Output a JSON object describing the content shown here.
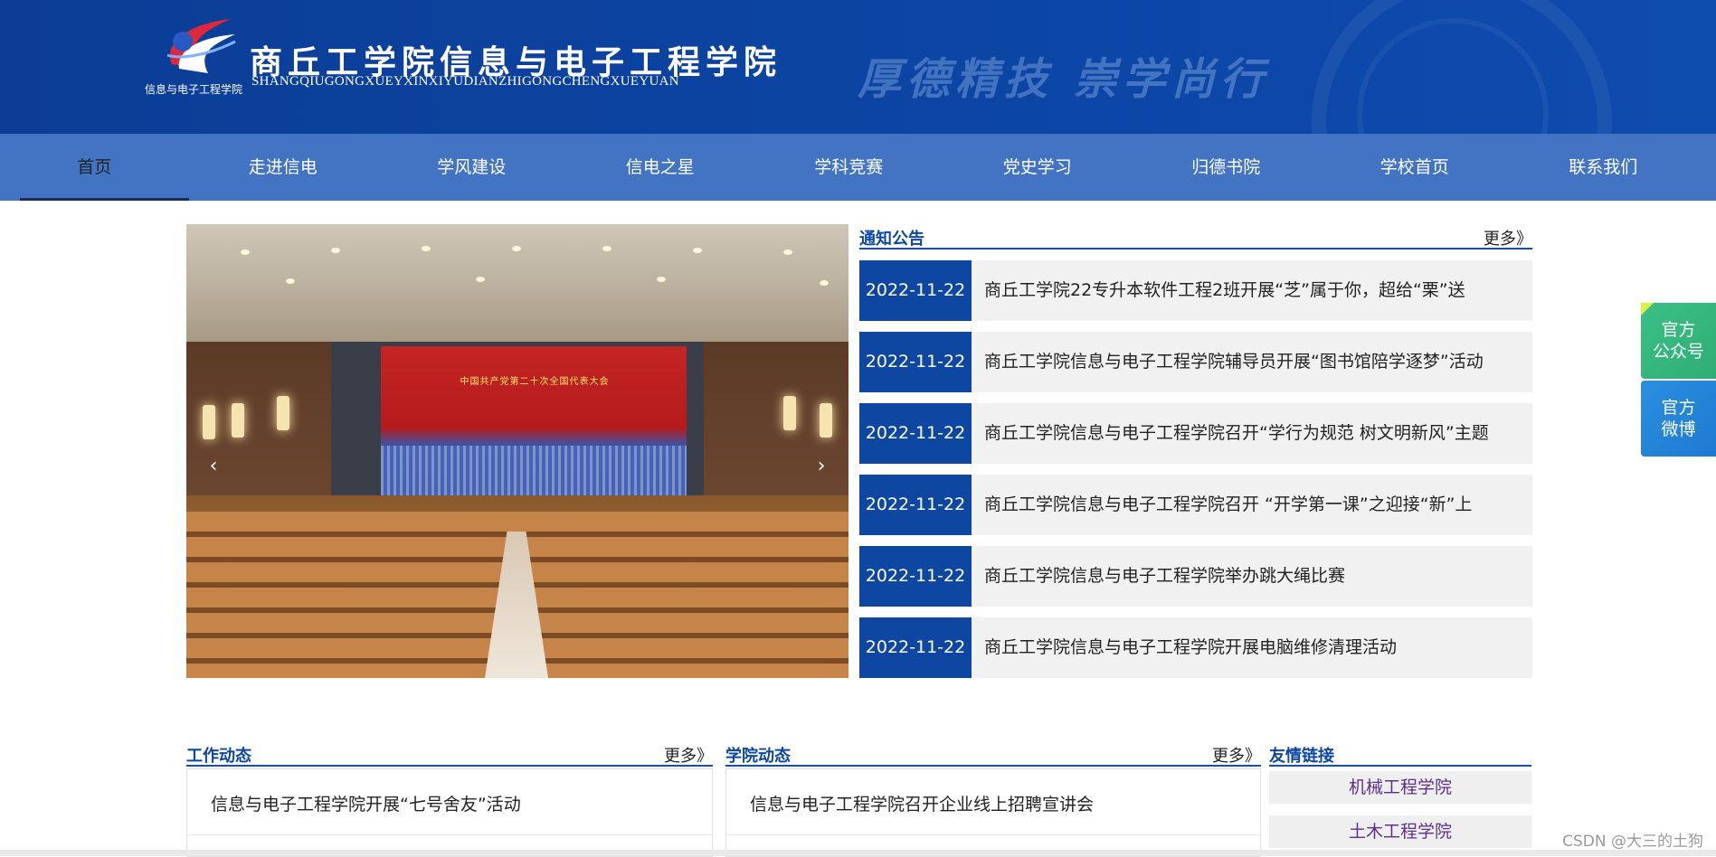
{
  "header": {
    "title": "商丘工学院信息与电子工程学院",
    "pinyin": "SHANGQIUGONGXUEYXINXIYUDIANZHIGONGCHENGXUEYUAN",
    "logo_text": "信息与电子工程学院",
    "motto": "厚德精技  崇学尚行"
  },
  "nav": {
    "items": [
      "首页",
      "走进信电",
      "学风建设",
      "信电之星",
      "学科竞赛",
      "党史学习",
      "归德书院",
      "学校首页",
      "联系我们"
    ],
    "active": "首页"
  },
  "banner": {
    "screen_caption": "中国共产党第二十次全国代表大会",
    "prev": "‹",
    "next": "›"
  },
  "notice": {
    "title": "通知公告",
    "more": "更多》",
    "items": [
      {
        "date": "2022-11-22",
        "title": "商丘工学院22专升本软件工程2班开展“芝”属于你，超给“栗”送"
      },
      {
        "date": "2022-11-22",
        "title": "商丘工学院信息与电子工程学院辅导员开展“图书馆陪学逐梦”活动"
      },
      {
        "date": "2022-11-22",
        "title": "商丘工学院信息与电子工程学院召开“学行为规范 树文明新风”主题"
      },
      {
        "date": "2022-11-22",
        "title": "商丘工学院信息与电子工程学院召开 “开学第一课”之迎接“新”上"
      },
      {
        "date": "2022-11-22",
        "title": "商丘工学院信息与电子工程学院举办跳大绳比赛"
      },
      {
        "date": "2022-11-22",
        "title": "商丘工学院信息与电子工程学院开展电脑维修清理活动"
      }
    ]
  },
  "float": {
    "wechat": "官方\n公众号",
    "weibo": "官方\n微博"
  },
  "work": {
    "title": "工作动态",
    "more": "更多》",
    "items": [
      "信息与电子工程学院开展“七号舍友”活动"
    ]
  },
  "college": {
    "title": "学院动态",
    "more": "更多》",
    "items": [
      "信息与电子工程学院召开企业线上招聘宣讲会"
    ]
  },
  "links": {
    "title": "友情链接",
    "items": [
      "机械工程学院",
      "土木工程学院"
    ]
  },
  "watermark": "CSDN @大三的土狗",
  "colors": {
    "header_bg": "#0c45a4",
    "nav_bg": "#4373c3",
    "date_bg": "#0d47a1",
    "link_text": "#5b2f93"
  }
}
